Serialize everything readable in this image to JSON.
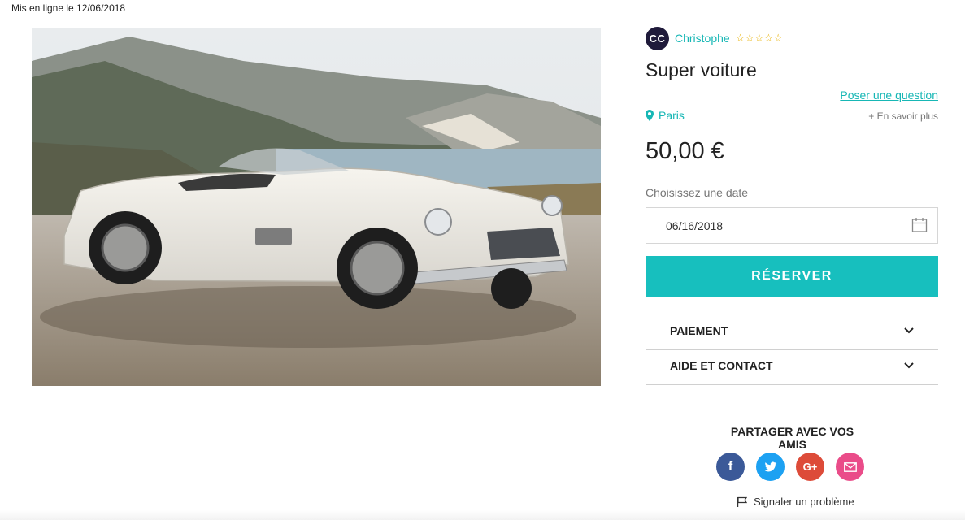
{
  "published": "Mis en ligne le 12/06/2018",
  "seller": {
    "initials": "CC",
    "name": "Christophe",
    "stars": "☆☆☆☆☆",
    "rating": 0
  },
  "listing": {
    "title": "Super voiture",
    "ask_question": "Poser une question",
    "location": "Paris",
    "learn_more": "+ En savoir plus",
    "price": "50,00 €"
  },
  "booking": {
    "date_label": "Choisissez une date",
    "date_value": "06/16/2018",
    "reserve_label": "RÉSERVER"
  },
  "accordion": [
    {
      "label": "PAIEMENT"
    },
    {
      "label": "AIDE ET CONTACT"
    }
  ],
  "share": {
    "title": "PARTAGER AVEC VOS AMIS",
    "networks": [
      {
        "icon": "facebook-icon",
        "glyph": "f",
        "color": "#3b5998"
      },
      {
        "icon": "twitter-icon",
        "glyph": "🐦",
        "color": "#1da1f2"
      },
      {
        "icon": "google-plus-icon",
        "glyph": "G+",
        "color": "#dd4b39"
      },
      {
        "icon": "email-icon",
        "glyph": "✉",
        "color": "#ea4c89"
      }
    ]
  },
  "report": "Signaler un problème",
  "colors": {
    "accent": "#17bfbe",
    "avatar": "#1f1a3a",
    "stars": "#e8b100"
  }
}
